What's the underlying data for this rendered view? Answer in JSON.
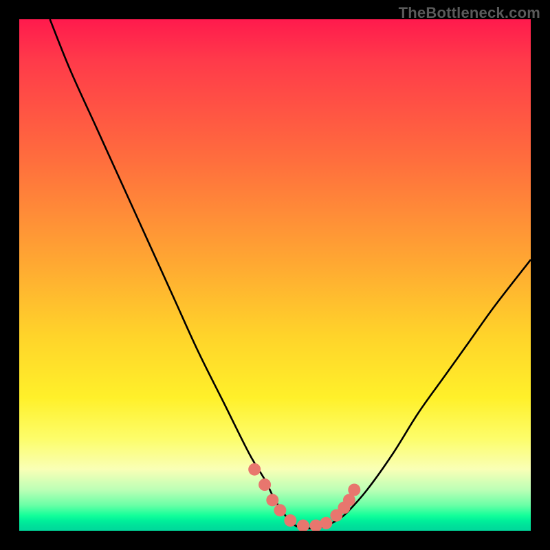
{
  "watermark": "TheBottleneck.com",
  "colors": {
    "frame": "#000000",
    "curve_stroke": "#000000",
    "marker_fill": "#e8766e",
    "marker_stroke": "#d95f58",
    "gradient_stops": [
      "#ff1a4d",
      "#ff3a4a",
      "#ff6f3d",
      "#ffa932",
      "#ffd42a",
      "#fff02a",
      "#fdfd6a",
      "#f9ffb6",
      "#bcffb6",
      "#6affa6",
      "#14ff9a",
      "#00f09a",
      "#00e19a",
      "#00d89b"
    ]
  },
  "chart_data": {
    "type": "line",
    "title": "",
    "xlabel": "",
    "ylabel": "",
    "xlim": [
      0,
      100
    ],
    "ylim": [
      0,
      100
    ],
    "series": [
      {
        "name": "bottleneck-curve",
        "x": [
          6,
          10,
          15,
          20,
          25,
          30,
          35,
          40,
          45,
          48,
          50,
          52,
          54,
          56,
          58,
          60,
          62,
          64,
          68,
          73,
          78,
          83,
          88,
          93,
          100
        ],
        "y": [
          100,
          90,
          79,
          68,
          57,
          46,
          35,
          25,
          15,
          10,
          6,
          3,
          1,
          0.5,
          0.5,
          1,
          2,
          3.5,
          8,
          15,
          23,
          30,
          37,
          44,
          53
        ]
      }
    ],
    "markers": {
      "name": "highlighted-points",
      "x": [
        46,
        48,
        49.5,
        51,
        53,
        55.5,
        58,
        60,
        62,
        63.5,
        64.5,
        65.5
      ],
      "y": [
        12,
        9,
        6,
        4,
        2,
        1,
        1,
        1.5,
        3,
        4.5,
        6,
        8
      ]
    }
  }
}
